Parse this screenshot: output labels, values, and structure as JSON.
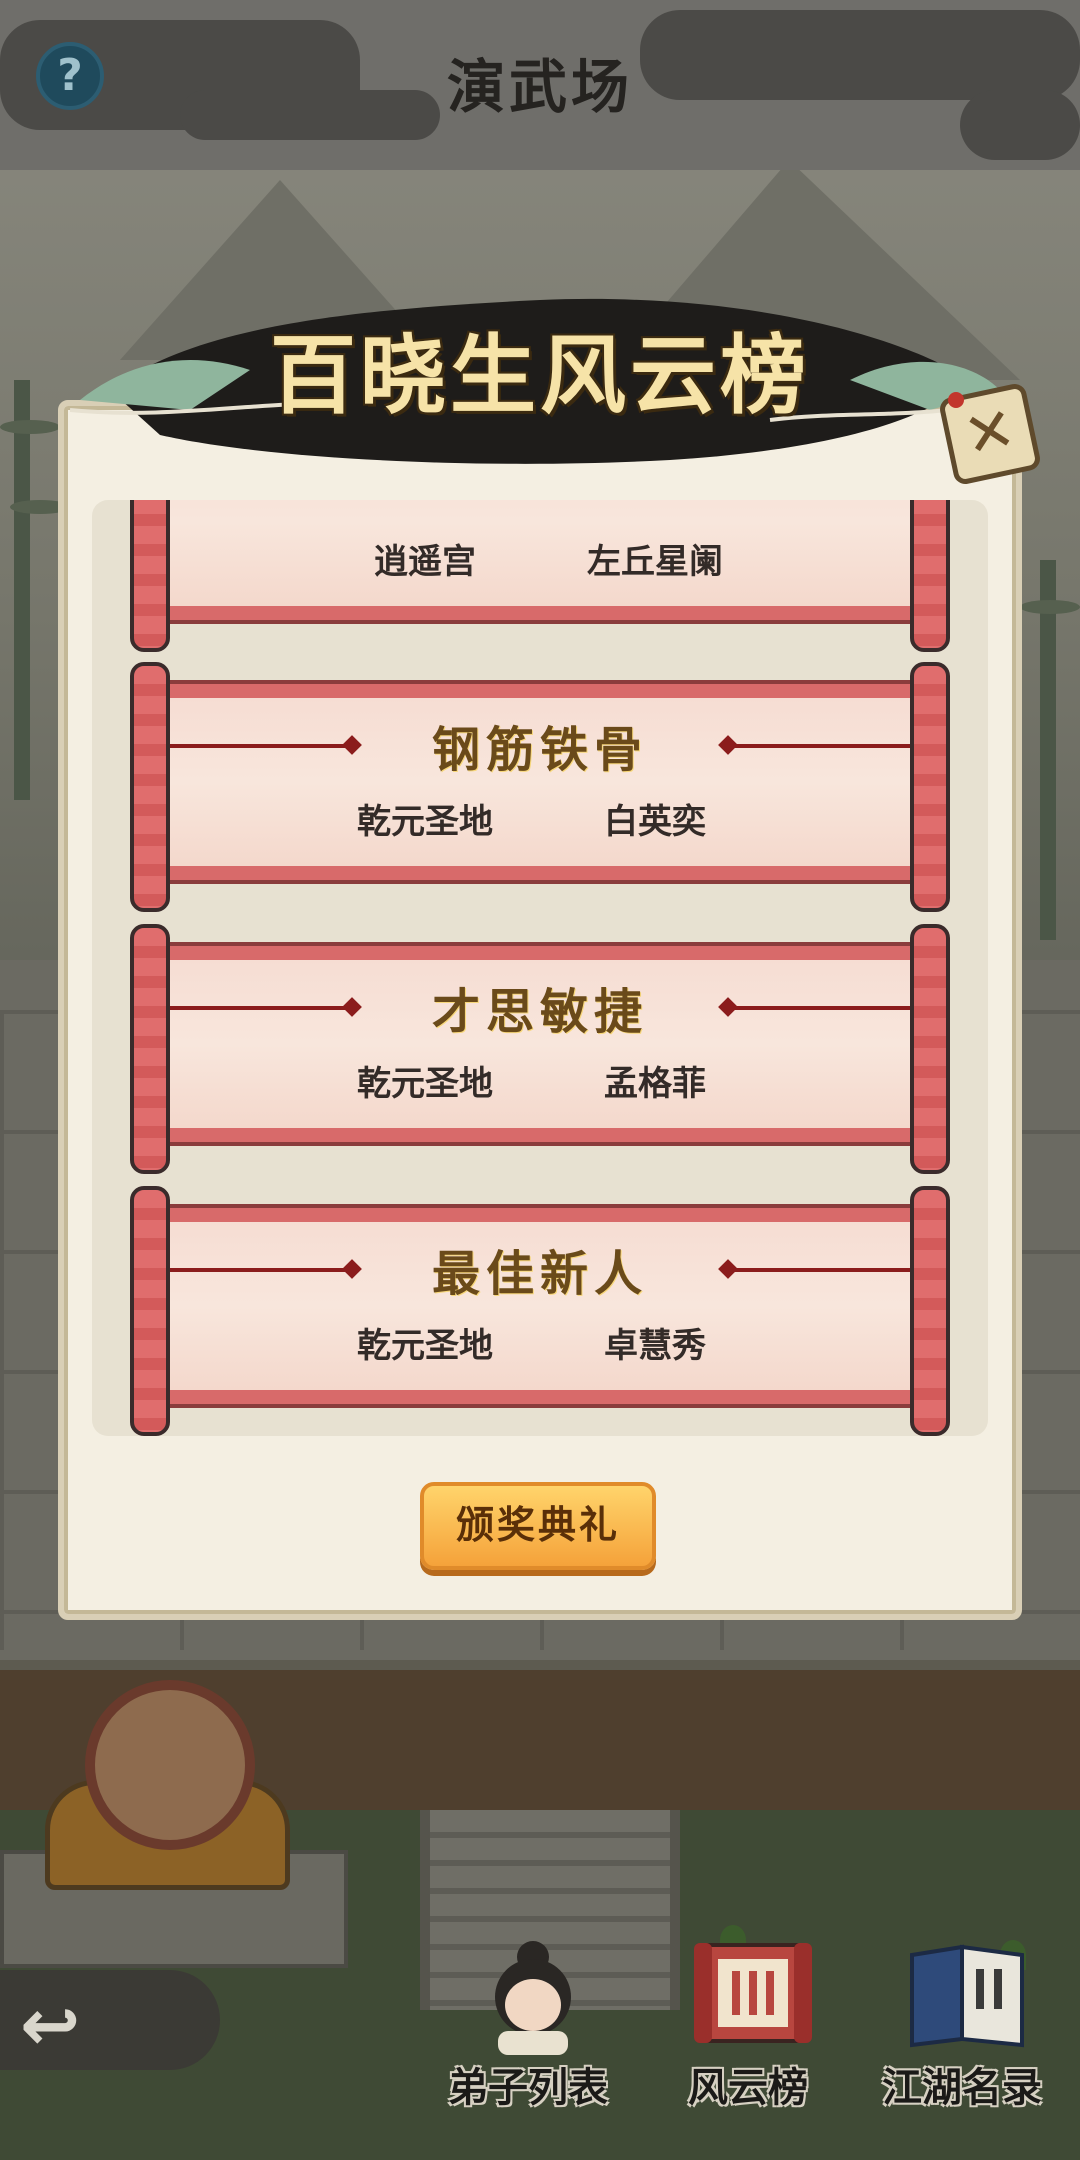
{
  "header": {
    "title": "演武场",
    "help_icon": "?"
  },
  "modal": {
    "title": "百晓生风云榜",
    "close_icon": "✕",
    "awards": [
      {
        "title": "",
        "sect": "逍遥宫",
        "name": "左丘星阑"
      },
      {
        "title": "钢筋铁骨",
        "sect": "乾元圣地",
        "name": "白英奕"
      },
      {
        "title": "才思敏捷",
        "sect": "乾元圣地",
        "name": "孟格菲"
      },
      {
        "title": "最佳新人",
        "sect": "乾元圣地",
        "name": "卓慧秀"
      }
    ],
    "action_button": "颁奖典礼"
  },
  "bottom_nav": {
    "back_icon": "↩",
    "items": [
      {
        "label": "弟子列表",
        "icon": "disciple-avatar-icon"
      },
      {
        "label": "风云榜",
        "icon": "scroll-board-icon"
      },
      {
        "label": "江湖名录",
        "icon": "book-icon"
      }
    ]
  },
  "colors": {
    "scroll_red": "#d86a6a",
    "award_gold": "#6a4a1a",
    "button_orange": "#f5a23a"
  }
}
